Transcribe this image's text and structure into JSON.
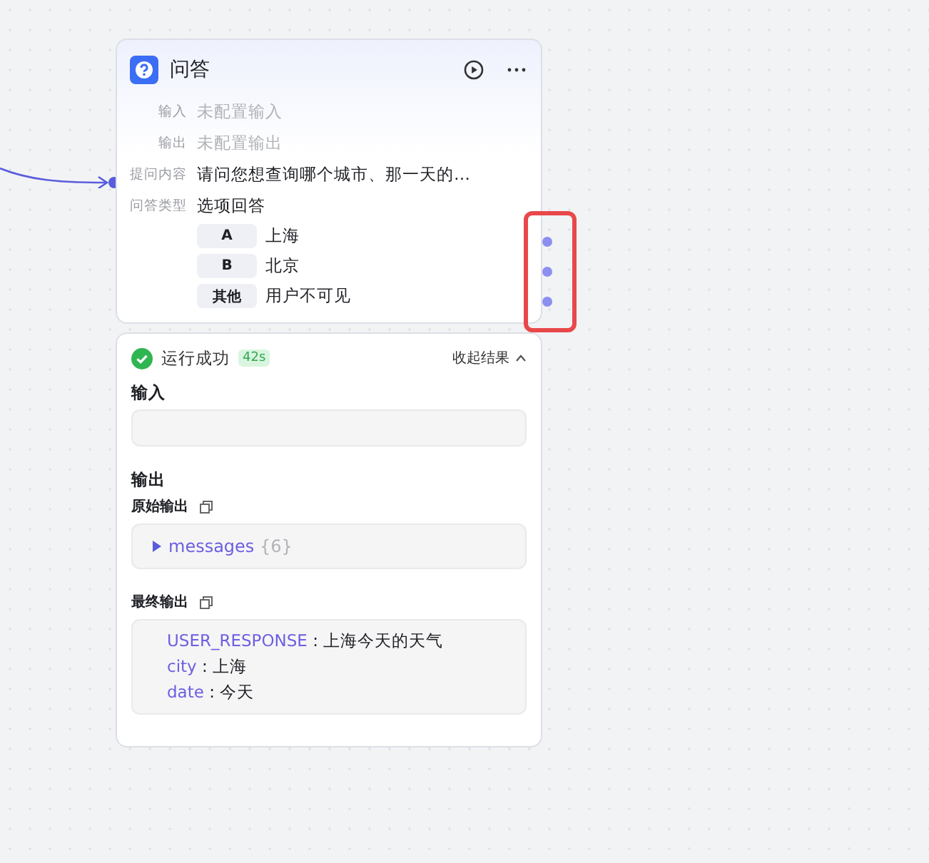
{
  "node": {
    "title": "问答",
    "fields": [
      {
        "label": "输入",
        "value": "未配置输入",
        "configured": false
      },
      {
        "label": "输出",
        "value": "未配置输出",
        "configured": false
      },
      {
        "label": "提问内容",
        "value": "请问您想查询哪个城市、那一天的…",
        "configured": true
      },
      {
        "label": "问答类型",
        "value": "选项回答",
        "configured": true
      }
    ],
    "options": [
      {
        "key": "A",
        "text": "上海"
      },
      {
        "key": "B",
        "text": "北京"
      },
      {
        "key": "其他",
        "text": "用户不可见"
      }
    ],
    "highlighted_ports": true
  },
  "result": {
    "status": "运行成功",
    "success": true,
    "duration": "42s",
    "collapse": "收起结果",
    "input_title": "输入",
    "output_title": "输出",
    "raw_label": "原始输出",
    "raw": {
      "key": "messages",
      "count": "{6}"
    },
    "final_label": "最终输出",
    "final": [
      {
        "key": "USER_RESPONSE",
        "separator": ":",
        "value": "上海今天的天气"
      },
      {
        "key": "city",
        "separator": ":",
        "value": "上海"
      },
      {
        "key": "date",
        "separator": ":",
        "value": "今天"
      }
    ]
  }
}
